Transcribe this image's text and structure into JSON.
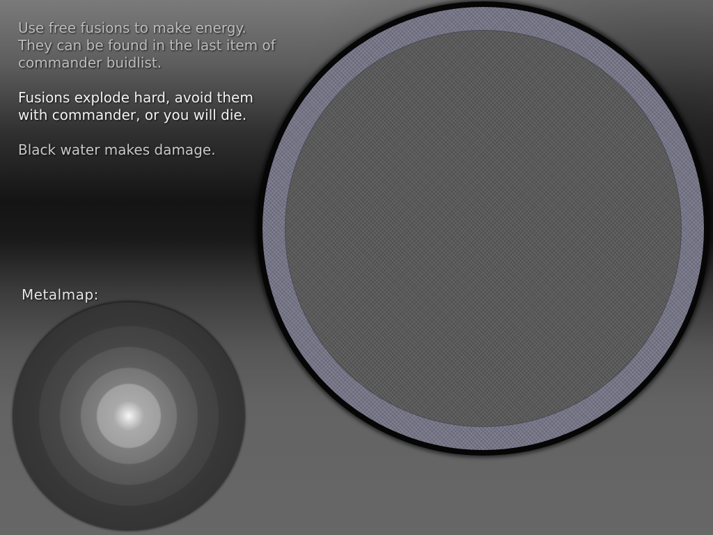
{
  "briefing": {
    "energy_tip": "Use free fusions to make energy.\nThey can be found in the last item of\ncommander buidlist.",
    "fusion_warning": "Fusions explode hard, avoid them\nwith commander, or you will die.",
    "water_warning": "Black water makes damage."
  },
  "metalmap": {
    "label": "Metalmap:"
  },
  "colors": {
    "shore_ring": "#737386",
    "ground": "#575757",
    "water": "#060606"
  }
}
